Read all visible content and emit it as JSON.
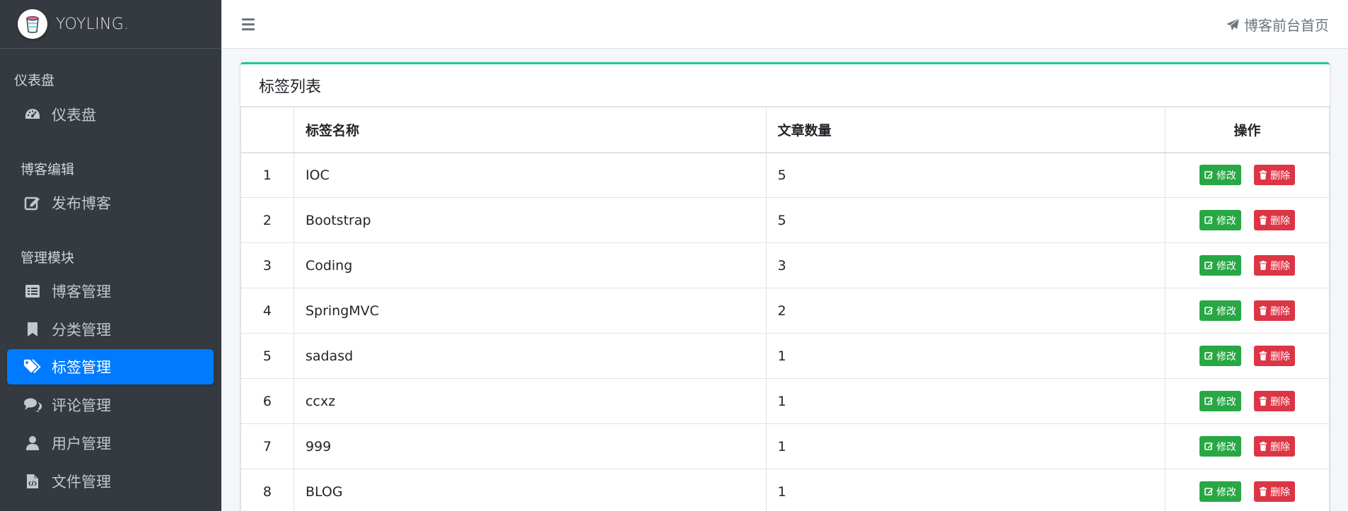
{
  "brand": {
    "name": "YOYLING."
  },
  "sidebar": {
    "sections": [
      {
        "header": "仪表盘",
        "items": [
          {
            "label": "仪表盘",
            "icon": "dashboard-icon"
          }
        ]
      },
      {
        "header": "博客编辑",
        "items": [
          {
            "label": "发布博客",
            "icon": "edit-icon"
          }
        ]
      },
      {
        "header": "管理模块",
        "items": [
          {
            "label": "博客管理",
            "icon": "list-icon"
          },
          {
            "label": "分类管理",
            "icon": "bookmark-icon"
          },
          {
            "label": "标签管理",
            "icon": "tags-icon",
            "active": true
          },
          {
            "label": "评论管理",
            "icon": "comments-icon"
          },
          {
            "label": "用户管理",
            "icon": "user-icon"
          },
          {
            "label": "文件管理",
            "icon": "file-code-icon"
          }
        ]
      }
    ]
  },
  "topbar": {
    "front_link": "博客前台首页"
  },
  "card": {
    "title": "标签列表",
    "columns": [
      "",
      "标签名称",
      "文章数量",
      "操作"
    ],
    "rows": [
      {
        "index": "1",
        "name": "IOC",
        "count": "5"
      },
      {
        "index": "2",
        "name": "Bootstrap",
        "count": "5"
      },
      {
        "index": "3",
        "name": "Coding",
        "count": "3"
      },
      {
        "index": "4",
        "name": "SpringMVC",
        "count": "2"
      },
      {
        "index": "5",
        "name": "sadasd",
        "count": "1"
      },
      {
        "index": "6",
        "name": "ccxz",
        "count": "1"
      },
      {
        "index": "7",
        "name": "999",
        "count": "1"
      },
      {
        "index": "8",
        "name": "BLOG",
        "count": "1"
      }
    ],
    "edit_label": "修改",
    "delete_label": "删除"
  },
  "colors": {
    "sidebar": "#343a40",
    "active": "#007bff",
    "accent": "#20c997",
    "edit": "#28a745",
    "delete": "#dc3545"
  }
}
